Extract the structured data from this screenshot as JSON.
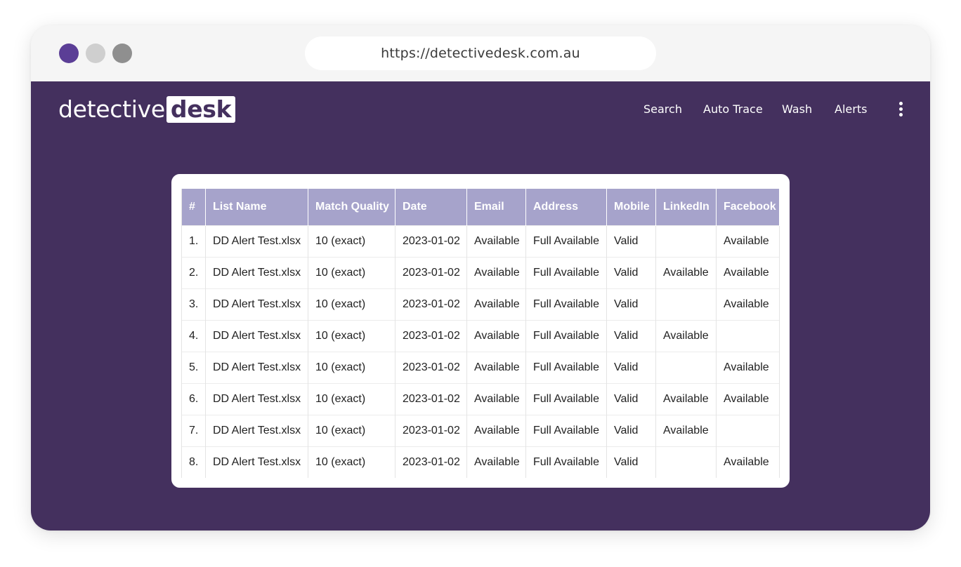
{
  "browser": {
    "url": "https://detectivedesk.com.au",
    "dots": [
      {
        "name": "close-dot",
        "color": "#5b3e96"
      },
      {
        "name": "minimize-dot",
        "color": "#cfcfcf"
      },
      {
        "name": "maximize-dot",
        "color": "#8f8f8f"
      }
    ]
  },
  "colors": {
    "site_bg": "#44305e",
    "header_bg": "#a6a3cb",
    "logo_desk_text": "#44305e"
  },
  "logo": {
    "part1": "detective",
    "part2": "desk"
  },
  "nav": {
    "items": [
      "Search",
      "Auto Trace",
      "Wash",
      "Alerts"
    ],
    "more_icon": "kebab-menu-icon"
  },
  "table": {
    "columns": [
      "#",
      "List Name",
      "Match Quality",
      "Date",
      "Email",
      "Address",
      "Mobile",
      "LinkedIn",
      "Facebook"
    ],
    "rows": [
      [
        "1.",
        "DD Alert Test.xlsx",
        "10 (exact)",
        "2023-01-02",
        "Available",
        "Full Available",
        "Valid",
        "",
        "Available"
      ],
      [
        "2.",
        "DD Alert Test.xlsx",
        "10 (exact)",
        "2023-01-02",
        "Available",
        "Full Available",
        "Valid",
        "Available",
        "Available"
      ],
      [
        "3.",
        "DD Alert Test.xlsx",
        "10 (exact)",
        "2023-01-02",
        "Available",
        "Full Available",
        "Valid",
        "",
        "Available"
      ],
      [
        "4.",
        "DD Alert Test.xlsx",
        "10 (exact)",
        "2023-01-02",
        "Available",
        "Full Available",
        "Valid",
        "Available",
        ""
      ],
      [
        "5.",
        "DD Alert Test.xlsx",
        "10 (exact)",
        "2023-01-02",
        "Available",
        "Full Available",
        "Valid",
        "",
        "Available"
      ],
      [
        "6.",
        "DD Alert Test.xlsx",
        "10 (exact)",
        "2023-01-02",
        "Available",
        "Full Available",
        "Valid",
        "Available",
        "Available"
      ],
      [
        "7.",
        "DD Alert Test.xlsx",
        "10 (exact)",
        "2023-01-02",
        "Available",
        "Full Available",
        "Valid",
        "Available",
        ""
      ],
      [
        "8.",
        "DD Alert Test.xlsx",
        "10 (exact)",
        "2023-01-02",
        "Available",
        "Full Available",
        "Valid",
        "",
        "Available"
      ]
    ]
  }
}
